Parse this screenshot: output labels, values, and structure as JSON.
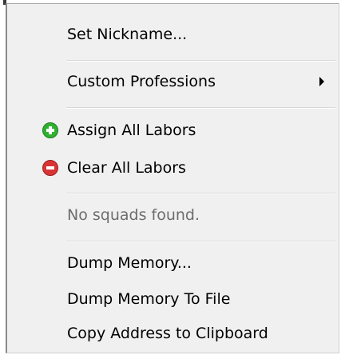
{
  "context_menu": {
    "items": {
      "set_nickname": {
        "label": "Set Nickname..."
      },
      "custom_professions": {
        "label": "Custom Professions",
        "has_submenu": true,
        "submenu_icon": "chevron-right-icon"
      },
      "assign_all_labors": {
        "label": "Assign All Labors",
        "icon": "add-circle-icon",
        "icon_color": "#2fb02f"
      },
      "clear_all_labors": {
        "label": "Clear All Labors",
        "icon": "remove-circle-icon",
        "icon_color": "#d93434"
      },
      "no_squads": {
        "label": "No squads found.",
        "disabled": true
      },
      "dump_memory": {
        "label": "Dump Memory..."
      },
      "dump_memory_to_file": {
        "label": "Dump Memory To File"
      },
      "copy_address": {
        "label": "Copy Address to Clipboard"
      }
    }
  }
}
